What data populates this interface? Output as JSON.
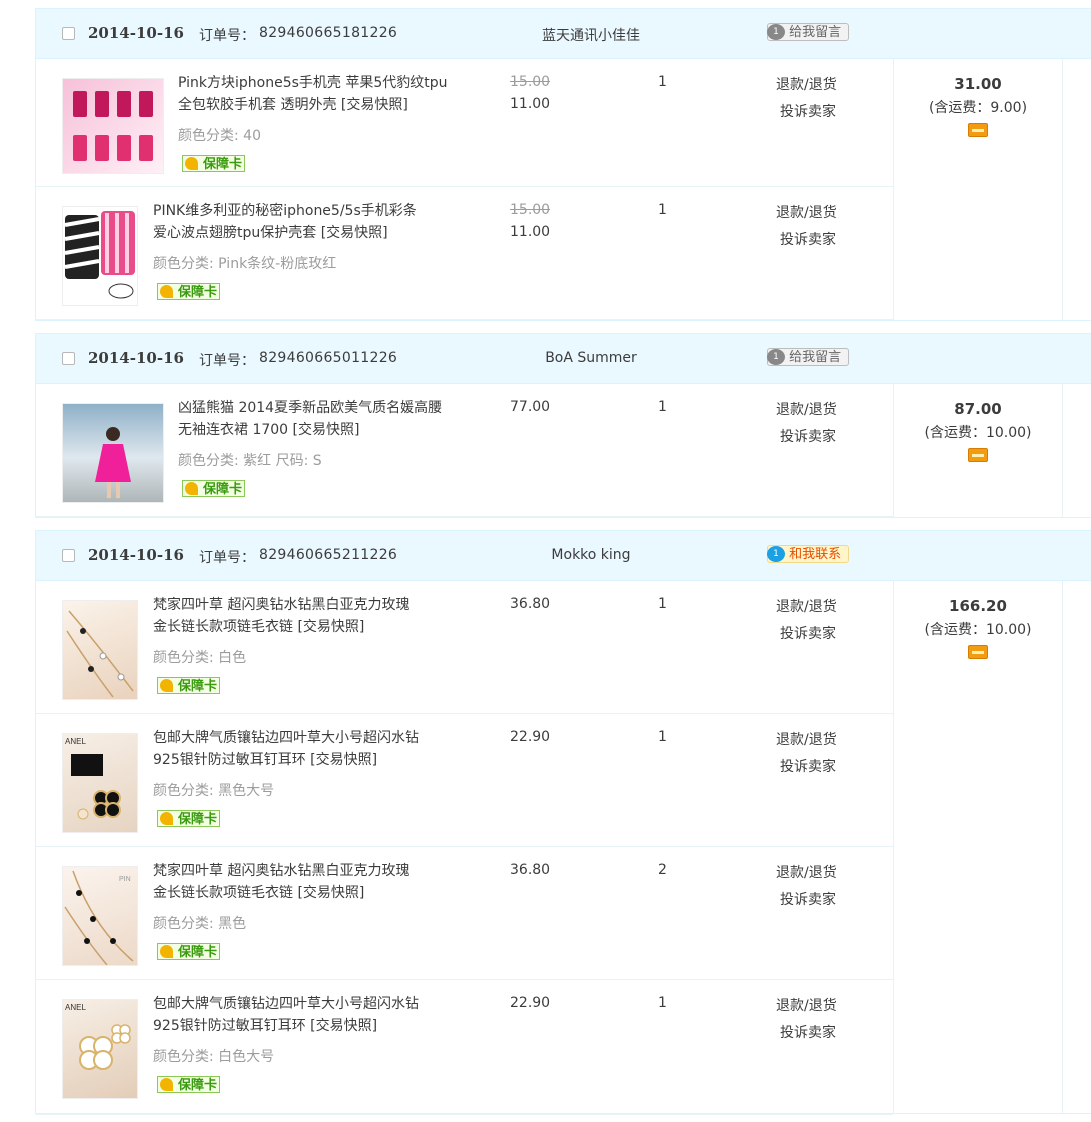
{
  "orders": [
    {
      "date": "2014-10-16",
      "order_no_label": "订单号：",
      "order_no": "829460665181226",
      "seller": "蓝天通讯小佳佳",
      "msg_button": "给我留言",
      "msg_bubble": "1",
      "total": "31.00",
      "shipping": "(含运费：9.00)",
      "items": [
        {
          "title": "Pink方块iphone5s手机壳 苹果5代豹纹tpu全包软胶手机套 透明外壳 [交易快照]",
          "sku": "颜色分类: 40",
          "badge": "保障卡",
          "price_old": "15.00",
          "price": "11.00",
          "qty": "1",
          "action1": "退款/退货",
          "action2": "投诉卖家"
        },
        {
          "title": "PINK维多利亚的秘密iphone5/5s手机彩条爱心波点翅膀tpu保护壳套 [交易快照]",
          "sku": "颜色分类: Pink条纹-粉底玫红",
          "badge": "保障卡",
          "price_old": "15.00",
          "price": "11.00",
          "qty": "1",
          "action1": "退款/退货",
          "action2": "投诉卖家"
        }
      ]
    },
    {
      "date": "2014-10-16",
      "order_no_label": "订单号：",
      "order_no": "829460665011226",
      "seller": "BoA Summer",
      "msg_button": "给我留言",
      "msg_bubble": "1",
      "total": "87.00",
      "shipping": "(含运费：10.00)",
      "items": [
        {
          "title": "凶猛熊猫 2014夏季新品欧美气质名媛高腰无袖连衣裙 1700 [交易快照]",
          "sku": "颜色分类: 紫红  尺码: S",
          "badge": "保障卡",
          "price_old": "",
          "price": "77.00",
          "qty": "1",
          "action1": "退款/退货",
          "action2": "投诉卖家"
        }
      ]
    },
    {
      "date": "2014-10-16",
      "order_no_label": "订单号：",
      "order_no": "829460665211226",
      "seller": "Mokko king",
      "msg_button": "和我联系",
      "msg_bubble": "1",
      "total": "166.20",
      "shipping": "(含运费：10.00)",
      "items": [
        {
          "title": "梵家四叶草 超闪奥钻水钻黑白亚克力玫瑰金长链长款项链毛衣链 [交易快照]",
          "sku": "颜色分类: 白色",
          "badge": "保障卡",
          "price_old": "",
          "price": "36.80",
          "qty": "1",
          "action1": "退款/退货",
          "action2": "投诉卖家"
        },
        {
          "title": "包邮大牌气质镶钻边四叶草大小号超闪水钻925银针防过敏耳钉耳环 [交易快照]",
          "sku": "颜色分类: 黑色大号",
          "badge": "保障卡",
          "price_old": "",
          "price": "22.90",
          "qty": "1",
          "action1": "退款/退货",
          "action2": "投诉卖家"
        },
        {
          "title": "梵家四叶草 超闪奥钻水钻黑白亚克力玫瑰金长链长款项链毛衣链 [交易快照]",
          "sku": "颜色分类: 黑色",
          "badge": "保障卡",
          "price_old": "",
          "price": "36.80",
          "qty": "2",
          "action1": "退款/退货",
          "action2": "投诉卖家"
        },
        {
          "title": "包邮大牌气质镶钻边四叶草大小号超闪水钻925银针防过敏耳钉耳环 [交易快照]",
          "sku": "颜色分类: 白色大号",
          "badge": "保障卡",
          "price_old": "",
          "price": "22.90",
          "qty": "1",
          "action1": "退款/退货",
          "action2": "投诉卖家"
        }
      ]
    }
  ]
}
